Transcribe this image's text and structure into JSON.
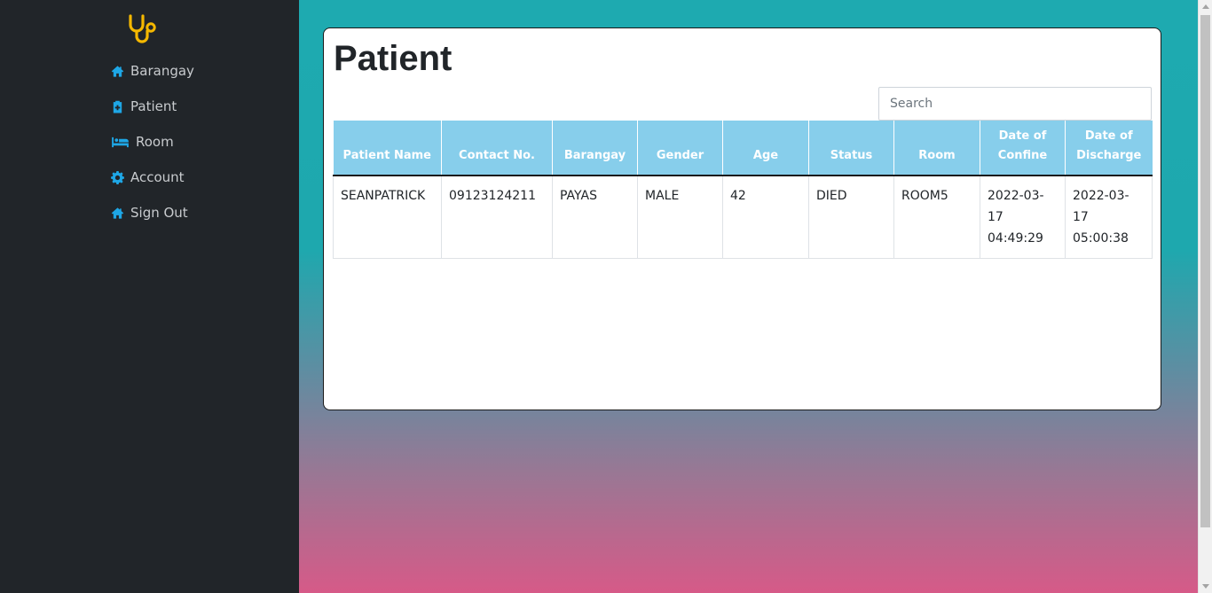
{
  "sidebar": {
    "logo_icon": "stethoscope-icon",
    "items": [
      {
        "label": "Barangay",
        "icon": "home-icon"
      },
      {
        "label": "Patient",
        "icon": "clipboard-plus-icon"
      },
      {
        "label": "Room",
        "icon": "bed-icon"
      },
      {
        "label": "Account",
        "icon": "gear-icon"
      },
      {
        "label": "Sign Out",
        "icon": "home-icon"
      }
    ]
  },
  "main": {
    "title": "Patient",
    "search": {
      "placeholder": "Search",
      "value": ""
    },
    "table": {
      "columns": [
        "Patient Name",
        "Contact No.",
        "Barangay",
        "Gender",
        "Age",
        "Status",
        "Room",
        "Date of Confine",
        "Date of Discharge"
      ],
      "rows": [
        [
          "SEANPATRICK",
          "09123124211",
          "PAYAS",
          "MALE",
          "42",
          "DIED",
          "ROOM5",
          "2022-03-17 04:49:29",
          "2022-03-17 05:00:38"
        ]
      ]
    }
  },
  "colors": {
    "sidebar_bg": "#212529",
    "accent_icon": "#1ea7e6",
    "logo": "#f5b800",
    "table_header": "#87ceeb",
    "gradient_top": "#1eaab0",
    "gradient_bottom": "#d65a88"
  }
}
